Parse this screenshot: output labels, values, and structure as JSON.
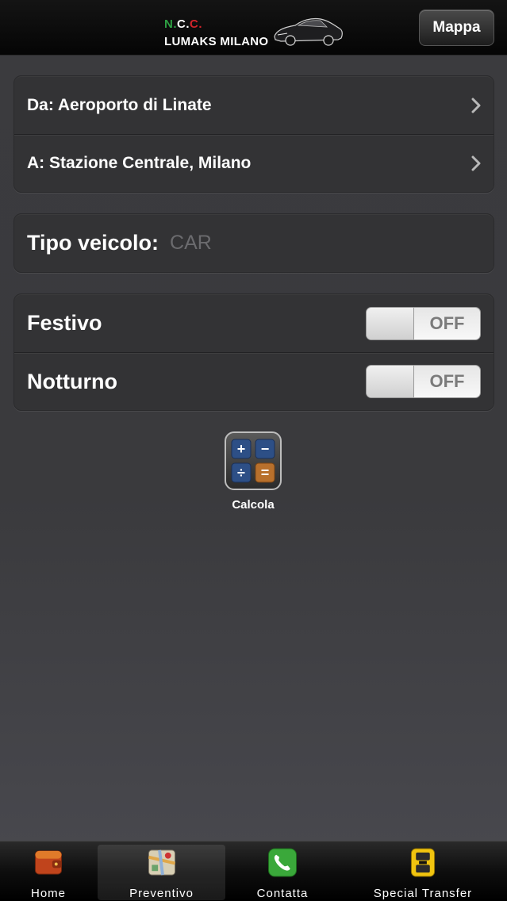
{
  "navbar": {
    "logo_ncc_n": "N.",
    "logo_ncc_c1": "C.",
    "logo_ncc_c2": "C.",
    "logo_name": "LUMAKS MILANO",
    "map_button": "Mappa"
  },
  "route": {
    "from_label": "Da: Aeroporto di Linate",
    "to_label": "A: Stazione Centrale, Milano"
  },
  "vehicle": {
    "label": "Tipo veicolo:",
    "value": "CAR"
  },
  "options": {
    "holiday_label": "Festivo",
    "holiday_state": "OFF",
    "night_label": "Notturno",
    "night_state": "OFF"
  },
  "calculate": {
    "label": "Calcola",
    "symbols": [
      "+",
      "−",
      "÷",
      "="
    ]
  },
  "tabbar": {
    "selected": "Preventivo",
    "items": [
      {
        "label": "Home",
        "icon": "wallet-icon"
      },
      {
        "label": "Preventivo",
        "icon": "map-icon"
      },
      {
        "label": "Contatta",
        "icon": "phone-icon"
      },
      {
        "label": "Special Transfer",
        "icon": "taxi-icon"
      }
    ]
  },
  "colors": {
    "background": "#3b3b3e",
    "cell": "#333335",
    "logo_green": "#2ea043",
    "logo_red": "#d0242a",
    "placeholder": "#6b6b6e"
  }
}
